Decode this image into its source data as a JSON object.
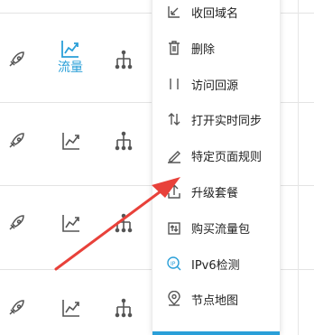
{
  "table": {
    "flow_label": "流量"
  },
  "menu": {
    "items": [
      {
        "label": "收回域名",
        "icon": "retrieve-domain-icon"
      },
      {
        "label": "删除",
        "icon": "trash-icon"
      },
      {
        "label": "访问回源",
        "icon": "origin-icon"
      },
      {
        "label": "打开实时同步",
        "icon": "sync-icon"
      },
      {
        "label": "特定页面规则",
        "icon": "pencil-icon"
      },
      {
        "label": "升级套餐",
        "icon": "upgrade-icon"
      },
      {
        "label": "购买流量包",
        "icon": "traffic-package-icon"
      },
      {
        "label": "IPv6检测",
        "icon": "ipv6-icon"
      },
      {
        "label": "节点地图",
        "icon": "map-pin-icon"
      }
    ]
  },
  "colors": {
    "accent": "#2a9fd8",
    "arrow": "#e8413a",
    "icon": "#555555"
  }
}
